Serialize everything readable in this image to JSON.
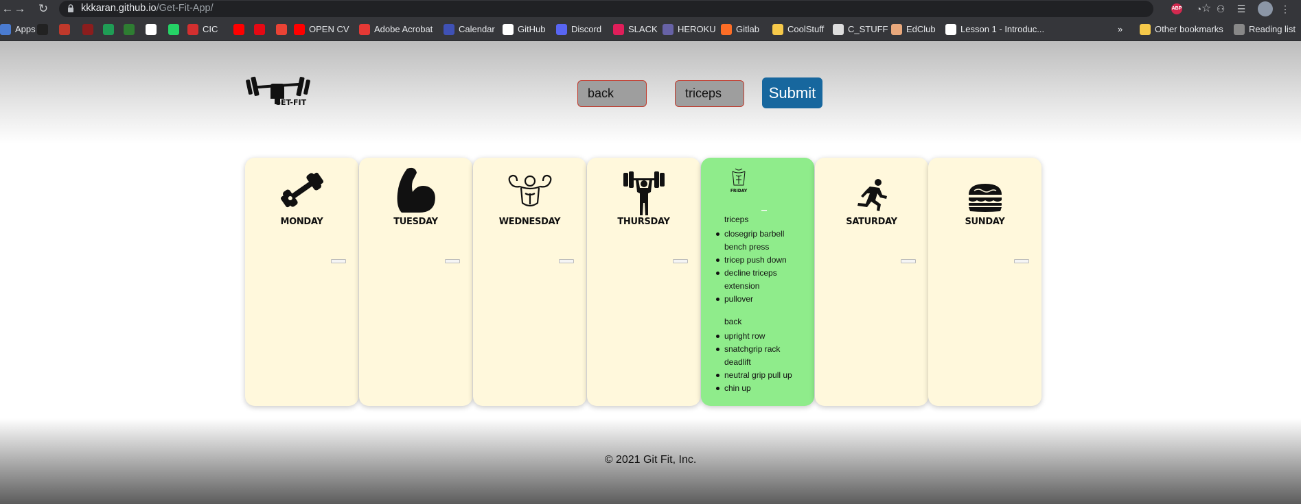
{
  "browser": {
    "url_domain": "kkkaran.github.io",
    "url_path": "/Get-Fit-App/",
    "ext_abp": "ABP",
    "bookmarks": [
      {
        "label": "Apps",
        "color": "#4a7bd0"
      },
      {
        "label": "",
        "color": "#222222"
      },
      {
        "label": "",
        "color": "#c0392b"
      },
      {
        "label": "",
        "color": "#8b1d1d"
      },
      {
        "label": "",
        "color": "#1f9d55"
      },
      {
        "label": "",
        "color": "#2e7d32"
      },
      {
        "label": "",
        "color": "#ffffff"
      },
      {
        "label": "",
        "color": "#25d366"
      },
      {
        "label": "CIC",
        "color": "#d32f2f"
      },
      {
        "label": "",
        "color": "#ff0000"
      },
      {
        "label": "",
        "color": "#e50914"
      },
      {
        "label": "",
        "color": "#ea4335"
      },
      {
        "label": "OPEN CV",
        "color": "#ff0000"
      },
      {
        "label": "Adobe Acrobat",
        "color": "#e53935"
      },
      {
        "label": "Calendar",
        "color": "#3f51b5"
      },
      {
        "label": "GitHub",
        "color": "#ffffff"
      },
      {
        "label": "Discord",
        "color": "#5865f2"
      },
      {
        "label": "SLACK",
        "color": "#e01e5a"
      },
      {
        "label": "HEROKU",
        "color": "#6762a6"
      },
      {
        "label": "Gitlab",
        "color": "#fc6d26"
      },
      {
        "label": "CoolStuff",
        "color": "#f6c94a"
      },
      {
        "label": "C_STUFF",
        "color": "#dddddd"
      },
      {
        "label": "EdClub",
        "color": "#e8a87c"
      },
      {
        "label": "Lesson 1 - Introduc...",
        "color": "#ffffff"
      }
    ],
    "overflow": "»",
    "other_bookmarks": "Other bookmarks",
    "reading_list": "Reading list"
  },
  "app": {
    "logo_text": "GET-FIT",
    "inputs": [
      {
        "value": "back"
      },
      {
        "value": "triceps"
      }
    ],
    "submit_label": "Submit",
    "days": [
      {
        "name": "MONDAY",
        "icon": "dumbbell-icon"
      },
      {
        "name": "TUESDAY",
        "icon": "flexed-arm-icon"
      },
      {
        "name": "WEDNESDAY",
        "icon": "bodybuilder-icon"
      },
      {
        "name": "THURSDAY",
        "icon": "weightlifter-icon"
      },
      {
        "name": "FRIDAY",
        "icon": "torso-icon"
      },
      {
        "name": "SATURDAY",
        "icon": "runner-icon"
      },
      {
        "name": "SUNDAY",
        "icon": "burger-icon"
      }
    ],
    "friday_workout": [
      {
        "group": "triceps",
        "exercises": [
          "closegrip barbell bench press",
          "tricep push down",
          "decline triceps extension",
          "pullover"
        ]
      },
      {
        "group": "back",
        "exercises": [
          "upright row",
          "snatchgrip rack deadlift",
          "neutral grip pull up",
          "chin up"
        ]
      }
    ],
    "footer": "© 2021 Git Fit, Inc."
  },
  "colors": {
    "card": "#fff8dc",
    "card_active": "#8fec8b",
    "submit": "#17679e",
    "input_border": "#c0392b"
  }
}
